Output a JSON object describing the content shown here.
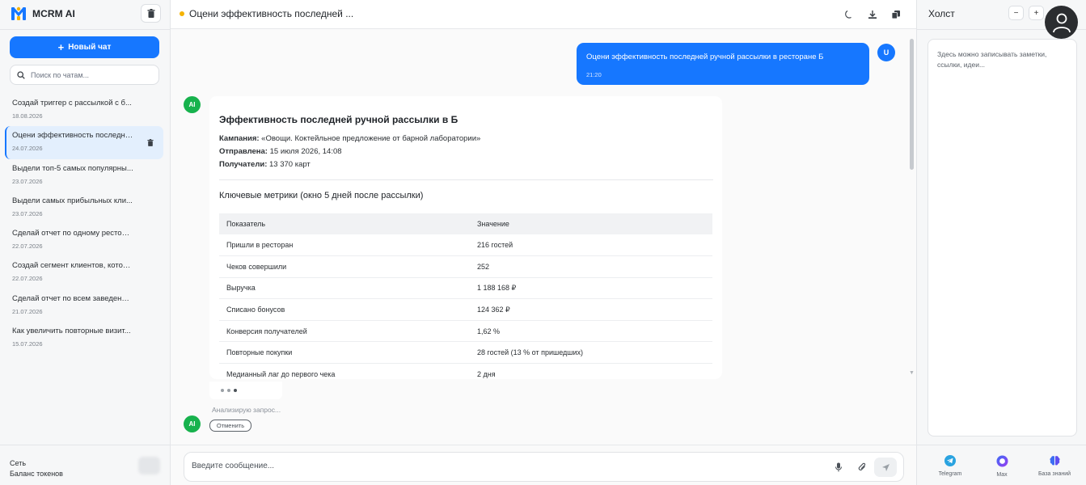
{
  "app": {
    "name": "MCRM AI"
  },
  "sidebar": {
    "new_chat_label": "Новый чат",
    "search_placeholder": "Поиск по чатам...",
    "chats": [
      {
        "title": "Создай триггер с рассылкой с б...",
        "date": "18.08.2026"
      },
      {
        "title": "Оцени эффективность последне...",
        "date": "24.07.2026"
      },
      {
        "title": "Выдели топ-5 самых популярны...",
        "date": "23.07.2026"
      },
      {
        "title": "Выдели самых прибыльных кли...",
        "date": "23.07.2026"
      },
      {
        "title": "Сделай отчет по одному рестора...",
        "date": "22.07.2026"
      },
      {
        "title": "Создай сегмент клиентов, котор...",
        "date": "22.07.2026"
      },
      {
        "title": "Сделай отчет по всем заведения...",
        "date": "21.07.2026"
      },
      {
        "title": "Как увеличить повторные визит...",
        "date": "15.07.2026"
      }
    ],
    "active_chat_index": 1,
    "footer": {
      "network_label": "Сеть",
      "balance_label": "Баланс токенов"
    }
  },
  "header": {
    "title": "Оцени эффективность последней ..."
  },
  "conversation": {
    "user_message": {
      "avatar": "U",
      "text": "Оцени эффективность последней ручной рассылки в ресторане Б",
      "time": "21:20"
    },
    "ai_avatar": "AI",
    "ai_message": {
      "heading": "Эффективность последней ручной рассылки в Б",
      "campaign_label": "Кампания:",
      "campaign_value": " «Овощи. Коктейльное предложение от барной лаборатории»",
      "sent_label": "Отправлена:",
      "sent_value": " 15 июля 2026, 14:08",
      "recipients_label": "Получатели:",
      "recipients_value": " 13 370 карт",
      "metrics_heading": "Ключевые метрики (окно 5 дней после рассылки)",
      "table": {
        "headers": [
          "Показатель",
          "Значение"
        ],
        "rows": [
          [
            "Пришли в ресторан",
            "216 гостей"
          ],
          [
            "Чеков совершили",
            "252"
          ],
          [
            "Выручка",
            "1 188 168 ₽"
          ],
          [
            "Списано бонусов",
            "124 362 ₽"
          ],
          [
            "Конверсия получателей",
            "1,62 %"
          ],
          [
            "Повторные покупки",
            "28 гостей (13 % от пришедших)"
          ],
          [
            "Медианный лаг до первого чека",
            "2 дня"
          ]
        ]
      }
    },
    "status_text": "Анализирую запрос...",
    "cancel_label": "Отменить"
  },
  "composer": {
    "placeholder": "Введите сообщение..."
  },
  "canvas": {
    "title": "Холст",
    "zoom_out": "−",
    "zoom_in": "+",
    "notes_placeholder": "Здесь можно записывать заметки, ссылки, идеи...",
    "links": [
      {
        "label": "Telegram",
        "icon": "telegram-icon"
      },
      {
        "label": "Max",
        "icon": "max-icon"
      },
      {
        "label": "База знаний",
        "icon": "brain-icon"
      }
    ]
  },
  "colors": {
    "accent": "#1677ff",
    "ai_green": "#17b24d",
    "status_dot": "#f5b301"
  }
}
